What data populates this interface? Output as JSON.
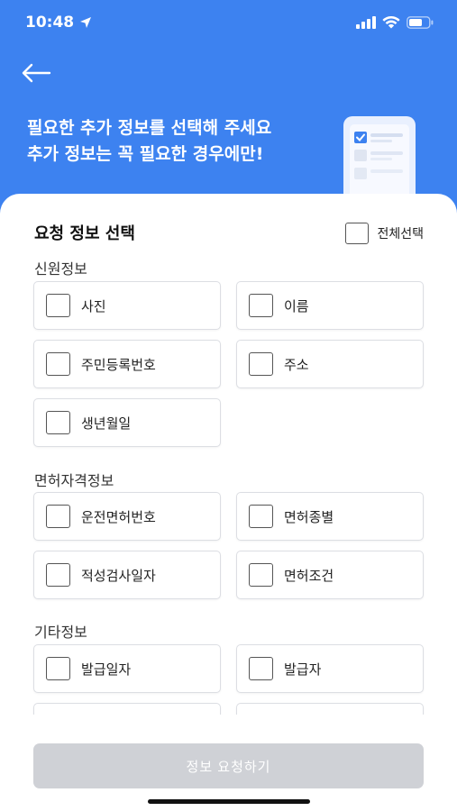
{
  "status_bar": {
    "time": "10:48"
  },
  "header": {
    "line1": "필요한 추가 정보를 선택해 주세요",
    "line2": "추가 정보는 꼭 필요한 경우에만!"
  },
  "sheet": {
    "title": "요청 정보 선택",
    "select_all_label": "전체선택",
    "sections": [
      {
        "title": "신원정보",
        "options": [
          "사진",
          "이름",
          "주민등록번호",
          "주소",
          "생년월일"
        ]
      },
      {
        "title": "면허자격정보",
        "options": [
          "운전면허번호",
          "면허종별",
          "적성검사일자",
          "면허조건"
        ]
      },
      {
        "title": "기타정보",
        "options": [
          "발급일자",
          "발급자"
        ]
      }
    ]
  },
  "submit_button": {
    "label": "정보 요청하기",
    "enabled": false
  },
  "colors": {
    "header_bg": "#3d82f0",
    "button_disabled": "#cfd1d6"
  },
  "icons": {
    "back": "arrow-left-icon",
    "location": "location-arrow-icon",
    "signal": "cellular-signal-icon",
    "wifi": "wifi-icon",
    "battery": "battery-icon",
    "checkbox": "checkbox-icon"
  }
}
